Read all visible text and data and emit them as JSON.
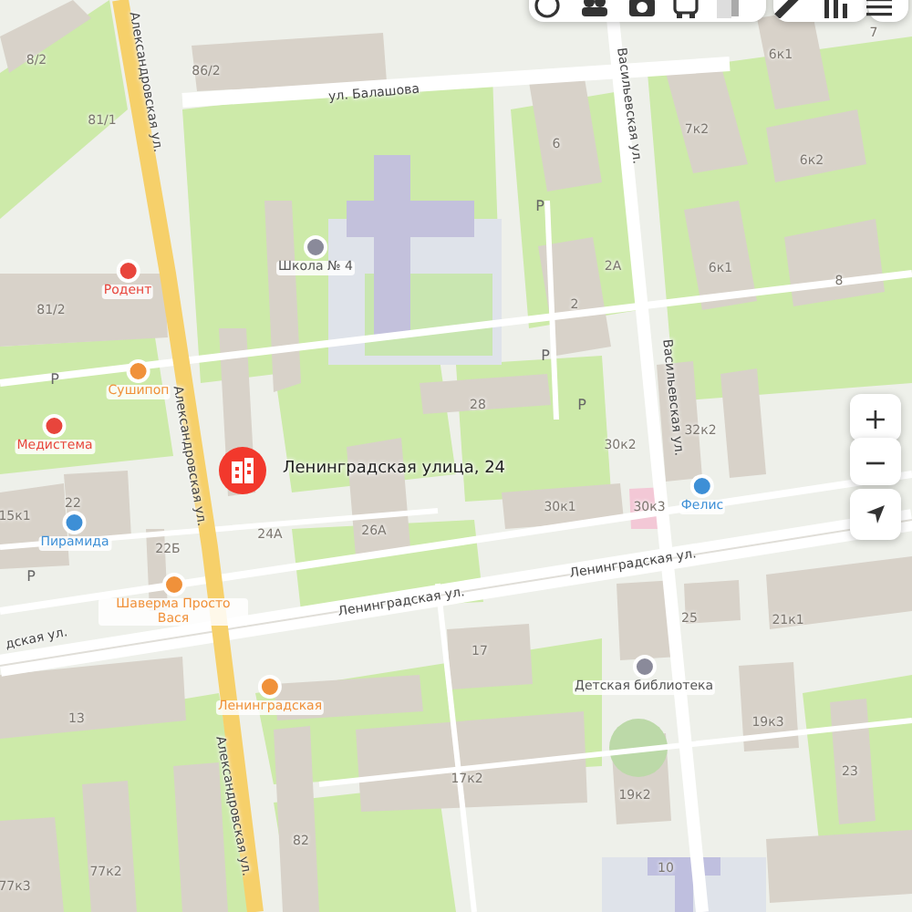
{
  "toolbar": {
    "buttons": [
      {
        "kind": "circle"
      },
      {
        "kind": "people"
      },
      {
        "kind": "camera"
      },
      {
        "kind": "bus"
      },
      {
        "kind": "layers"
      },
      {
        "kind": "ruler"
      },
      {
        "kind": "bars"
      },
      {
        "kind": "menu"
      }
    ]
  },
  "map": {
    "streets": [
      "ул. Балашова",
      "Александровская ул.",
      "Александровская ул.",
      "Александровская ул.",
      "Васильевская ул.",
      "Васильевская ул.",
      "Ленинградская ул.",
      "Ленинградская ул.",
      "дская ул."
    ],
    "pois": [
      {
        "name": "Школа № 4",
        "color": "#8a8a9a"
      },
      {
        "name": "Родент",
        "color": "#e8453c"
      },
      {
        "name": "Сушипоп",
        "color": "#f0913a"
      },
      {
        "name": "Медистема",
        "color": "#e8453c"
      },
      {
        "name": "Пирамида",
        "color": "#3d8fd6"
      },
      {
        "name": "Шаверма Просто Вася",
        "color": "#f0913a"
      },
      {
        "name": "Ленинградская",
        "color": "#f0913a"
      },
      {
        "name": "Фелис",
        "color": "#3d8fd6"
      },
      {
        "name": "Детская библиотека",
        "color": "#8a8a9a"
      }
    ],
    "house_numbers": [
      "8/2",
      "86/2",
      "81/1",
      "81/2",
      "22",
      "15к1",
      "22Б",
      "24А",
      "26А",
      "13",
      "77к2",
      "77к3",
      "82",
      "6",
      "7к2",
      "6к1",
      "6к2",
      "6к1",
      "8",
      "7",
      "2А",
      "2",
      "28",
      "30к2",
      "32к2",
      "30к1",
      "30к3",
      "25",
      "21к1",
      "17",
      "17к2",
      "19к3",
      "19к2",
      "23",
      "10"
    ],
    "parking_signs": [
      "P",
      "P",
      "P",
      "P",
      "P"
    ],
    "address_pin": {
      "label": "Ленинградская улица, 24"
    }
  },
  "controls": {
    "zoom_in": "+",
    "zoom_out": "−"
  }
}
